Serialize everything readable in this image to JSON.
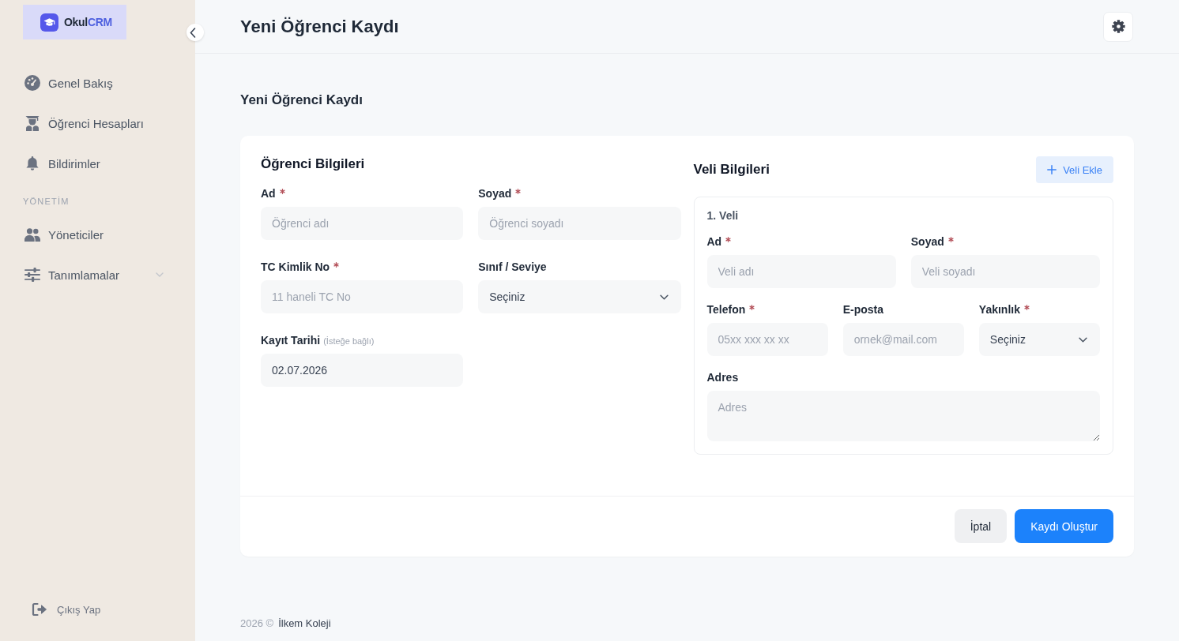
{
  "sidebar": {
    "logo": {
      "name": "Okul",
      "accent": "CRM"
    },
    "sections": [
      {
        "items": [
          {
            "kind": "link",
            "label": "Genel Bakış"
          },
          {
            "kind": "link",
            "label": "Öğrenci Hesapları"
          },
          {
            "kind": "link",
            "label": "Bildirimler"
          }
        ]
      },
      {
        "heading": "YÖNETİM",
        "items": [
          {
            "kind": "link",
            "label": "Yöneticiler"
          },
          {
            "kind": "group",
            "label": "Tanımlamalar",
            "expanded": false
          }
        ]
      }
    ],
    "logout": {
      "label": "Çıkış Yap"
    }
  },
  "header": {
    "title": "Yeni Öğrenci Kaydı"
  },
  "page_title": "Yeni Öğrenci Kaydı",
  "form": {
    "student": {
      "title": "Öğrenci Bilgileri",
      "fields": [
        {
          "kind": "text",
          "label": "Ad",
          "required": true,
          "placeholder": "Öğrenci adı"
        },
        {
          "kind": "text",
          "label": "Soyad",
          "required": true,
          "placeholder": "Öğrenci soyadı"
        },
        {
          "kind": "text",
          "label": "TC Kimlik No",
          "required": true,
          "placeholder": "11 haneli TC No"
        },
        {
          "kind": "select",
          "label": "Sınıf / Seviye",
          "required": false,
          "value": "Seçiniz"
        },
        {
          "kind": "date",
          "label": "Kayıt Tarihi",
          "hint": "(İsteğe bağlı)",
          "required": false,
          "value": "02.07.2026"
        }
      ]
    },
    "guardians": {
      "title": "Veli Bilgileri",
      "add_button": "Veli Ekle",
      "items": [
        {
          "title": "1. Veli",
          "rows": [
            {
              "fields": [
                {
                  "kind": "text",
                  "label": "Ad",
                  "required": true,
                  "placeholder": "Veli adı"
                },
                {
                  "kind": "text",
                  "label": "Soyad",
                  "required": true,
                  "placeholder": "Veli soyadı"
                }
              ]
            },
            {
              "fields": [
                {
                  "kind": "text",
                  "label": "Telefon",
                  "required": true,
                  "placeholder": "05xx xxx xx xx"
                },
                {
                  "kind": "text",
                  "label": "E-posta",
                  "required": false,
                  "placeholder": "ornek@mail.com"
                },
                {
                  "kind": "select",
                  "label": "Yakınlık",
                  "required": true,
                  "value": "Seçiniz"
                }
              ]
            },
            {
              "fields": [
                {
                  "kind": "textarea",
                  "label": "Adres",
                  "required": false,
                  "placeholder": "Adres"
                }
              ]
            }
          ]
        }
      ]
    },
    "actions": [
      {
        "kind": "secondary",
        "label": "İptal"
      },
      {
        "kind": "primary",
        "label": "Kaydı Oluştur"
      }
    ]
  },
  "footer": {
    "copyright": "2026 ©",
    "owner": "İlkem Koleji"
  }
}
